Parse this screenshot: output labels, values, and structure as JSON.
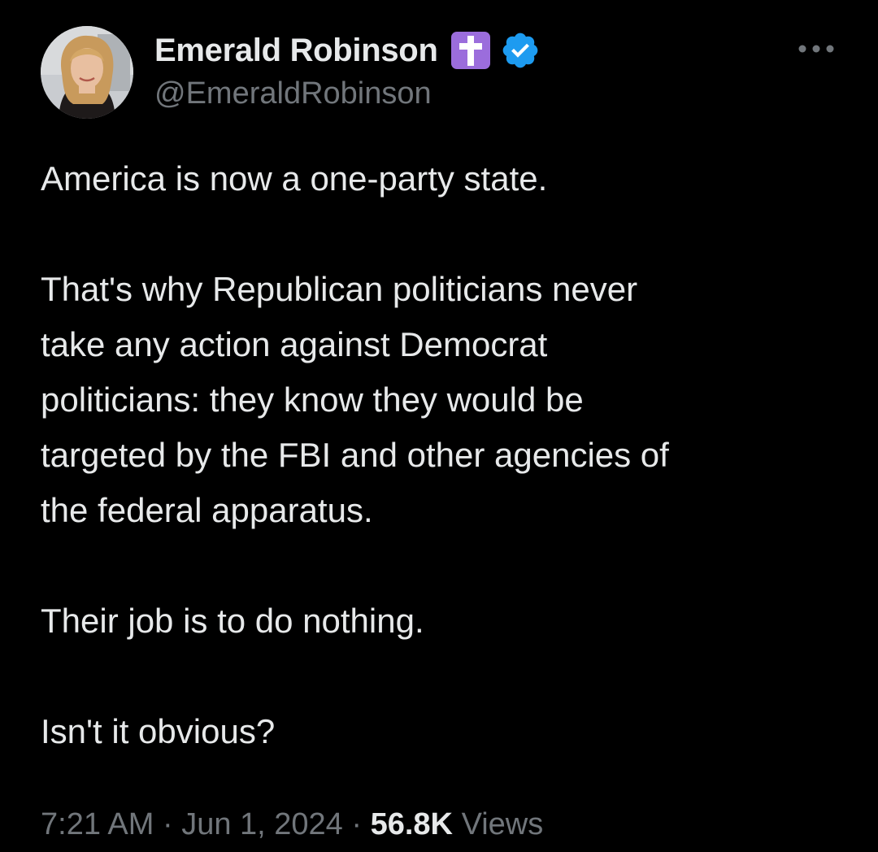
{
  "author": {
    "display_name": "Emerald Robinson",
    "handle": "@EmeraldRobinson",
    "badges": [
      "latin-cross-icon",
      "verified-icon"
    ],
    "verified_color": "#1d9bf0",
    "cross_badge_color": "#9b6ddc"
  },
  "more_menu": {
    "icon": "more-horizontal-icon"
  },
  "tweet": {
    "paragraphs": [
      "America is now a one-party state.",
      "That's why Republican politicians never\ntake any action against Democrat\npoliticians: they know they would be\ntargeted by the FBI and other agencies of\nthe federal apparatus.",
      "Their job is to do nothing.",
      "Isn't it obvious?"
    ]
  },
  "meta": {
    "time": "7:21 AM",
    "separator": "·",
    "date": "Jun 1, 2024",
    "views_count": "56.8K",
    "views_label": "Views"
  }
}
